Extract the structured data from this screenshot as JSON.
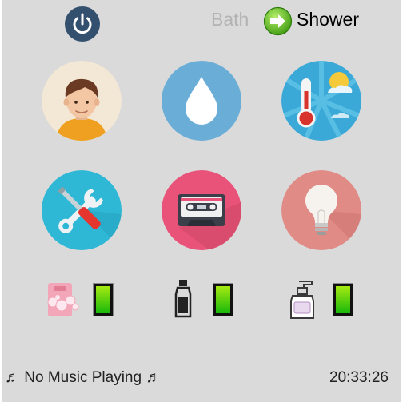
{
  "header": {
    "power_icon": "power-icon",
    "mode_inactive_label": "Bath",
    "mode_active_label": "Shower",
    "mode_switch_icon": "right-arrow-icon"
  },
  "tiles": [
    {
      "name": "user",
      "icon": "person-avatar-icon",
      "color": "#f2e6d3"
    },
    {
      "name": "water",
      "icon": "water-drop-icon",
      "color": "#6aaed8"
    },
    {
      "name": "weather",
      "icon": "weather-thermometer-icon",
      "color": "#3aa9d8"
    },
    {
      "name": "settings",
      "icon": "tools-icon",
      "color": "#2eb8d6"
    },
    {
      "name": "music",
      "icon": "cassette-tape-icon",
      "color": "#e9537a"
    },
    {
      "name": "light",
      "icon": "light-bulb-icon",
      "color": "#e08b86"
    }
  ],
  "supplies": [
    {
      "name": "bath-foam",
      "icon": "bath-foam-icon",
      "level": 1.0
    },
    {
      "name": "shampoo",
      "icon": "shampoo-bottle-icon",
      "level": 1.0
    },
    {
      "name": "soap",
      "icon": "soap-dispenser-icon",
      "level": 1.0
    }
  ],
  "footer": {
    "music_status": "♬ No Music Playing ♬",
    "clock": "20:33:26"
  }
}
